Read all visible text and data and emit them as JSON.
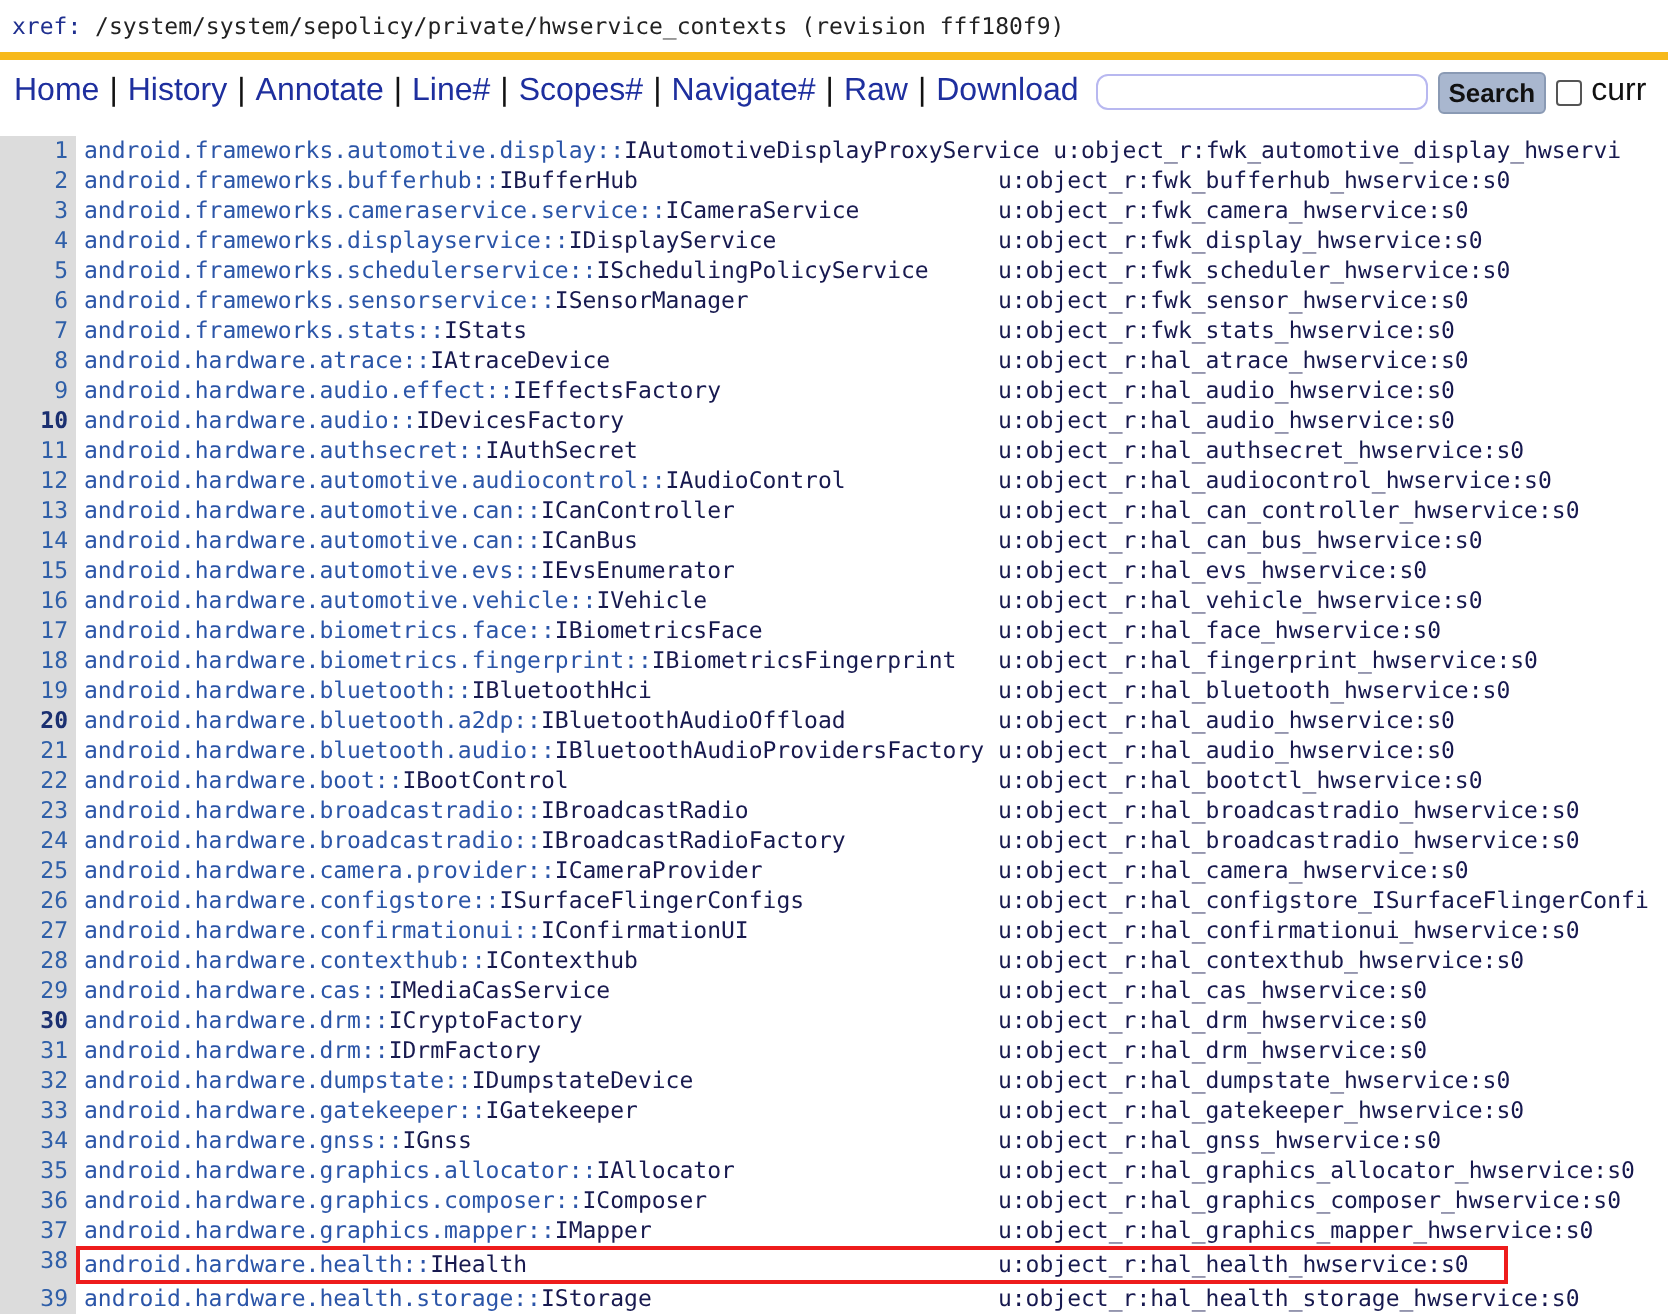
{
  "header": {
    "prefix": "xref:",
    "path": "/system/system/sepolicy/private/hwservice_contexts (revision fff180f9)"
  },
  "nav": [
    {
      "kind": "link",
      "label": "Home"
    },
    {
      "kind": "separator",
      "label": "|"
    },
    {
      "kind": "link",
      "label": "History"
    },
    {
      "kind": "separator",
      "label": "|"
    },
    {
      "kind": "link",
      "label": "Annotate"
    },
    {
      "kind": "separator",
      "label": "|"
    },
    {
      "kind": "link",
      "label": "Line#"
    },
    {
      "kind": "separator",
      "label": "|"
    },
    {
      "kind": "link",
      "label": "Scopes#"
    },
    {
      "kind": "separator",
      "label": "|"
    },
    {
      "kind": "link",
      "label": "Navigate#"
    },
    {
      "kind": "separator",
      "label": "|"
    },
    {
      "kind": "link",
      "label": "Raw"
    },
    {
      "kind": "separator",
      "label": "|"
    },
    {
      "kind": "link",
      "label": "Download"
    }
  ],
  "search": {
    "button": "Search",
    "checkbox_checked": false,
    "checkbox_label": "curr"
  },
  "lines": [
    {
      "number": "1",
      "pkg": "android.frameworks.automotive.display::",
      "iface": "IAutomotiveDisplayProxyService",
      "context": "u:object_r:fwk_automotive_display_hwservi",
      "highlighted": false
    },
    {
      "number": "2",
      "pkg": "android.frameworks.bufferhub::",
      "iface": "IBufferHub",
      "context": "u:object_r:fwk_bufferhub_hwservice:s0",
      "highlighted": false
    },
    {
      "number": "3",
      "pkg": "android.frameworks.cameraservice.service::",
      "iface": "ICameraService",
      "context": "u:object_r:fwk_camera_hwservice:s0",
      "highlighted": false
    },
    {
      "number": "4",
      "pkg": "android.frameworks.displayservice::",
      "iface": "IDisplayService",
      "context": "u:object_r:fwk_display_hwservice:s0",
      "highlighted": false
    },
    {
      "number": "5",
      "pkg": "android.frameworks.schedulerservice::",
      "iface": "ISchedulingPolicyService",
      "context": "u:object_r:fwk_scheduler_hwservice:s0",
      "highlighted": false
    },
    {
      "number": "6",
      "pkg": "android.frameworks.sensorservice::",
      "iface": "ISensorManager",
      "context": "u:object_r:fwk_sensor_hwservice:s0",
      "highlighted": false
    },
    {
      "number": "7",
      "pkg": "android.frameworks.stats::",
      "iface": "IStats",
      "context": "u:object_r:fwk_stats_hwservice:s0",
      "highlighted": false
    },
    {
      "number": "8",
      "pkg": "android.hardware.atrace::",
      "iface": "IAtraceDevice",
      "context": "u:object_r:hal_atrace_hwservice:s0",
      "highlighted": false
    },
    {
      "number": "9",
      "pkg": "android.hardware.audio.effect::",
      "iface": "IEffectsFactory",
      "context": "u:object_r:hal_audio_hwservice:s0",
      "highlighted": false
    },
    {
      "number": "10",
      "pkg": "android.hardware.audio::",
      "iface": "IDevicesFactory",
      "context": "u:object_r:hal_audio_hwservice:s0",
      "highlighted": false
    },
    {
      "number": "11",
      "pkg": "android.hardware.authsecret::",
      "iface": "IAuthSecret",
      "context": "u:object_r:hal_authsecret_hwservice:s0",
      "highlighted": false
    },
    {
      "number": "12",
      "pkg": "android.hardware.automotive.audiocontrol::",
      "iface": "IAudioControl",
      "context": "u:object_r:hal_audiocontrol_hwservice:s0",
      "highlighted": false
    },
    {
      "number": "13",
      "pkg": "android.hardware.automotive.can::",
      "iface": "ICanController",
      "context": "u:object_r:hal_can_controller_hwservice:s0",
      "highlighted": false
    },
    {
      "number": "14",
      "pkg": "android.hardware.automotive.can::",
      "iface": "ICanBus",
      "context": "u:object_r:hal_can_bus_hwservice:s0",
      "highlighted": false
    },
    {
      "number": "15",
      "pkg": "android.hardware.automotive.evs::",
      "iface": "IEvsEnumerator",
      "context": "u:object_r:hal_evs_hwservice:s0",
      "highlighted": false
    },
    {
      "number": "16",
      "pkg": "android.hardware.automotive.vehicle::",
      "iface": "IVehicle",
      "context": "u:object_r:hal_vehicle_hwservice:s0",
      "highlighted": false
    },
    {
      "number": "17",
      "pkg": "android.hardware.biometrics.face::",
      "iface": "IBiometricsFace",
      "context": "u:object_r:hal_face_hwservice:s0",
      "highlighted": false
    },
    {
      "number": "18",
      "pkg": "android.hardware.biometrics.fingerprint::",
      "iface": "IBiometricsFingerprint",
      "context": "u:object_r:hal_fingerprint_hwservice:s0",
      "highlighted": false
    },
    {
      "number": "19",
      "pkg": "android.hardware.bluetooth::",
      "iface": "IBluetoothHci",
      "context": "u:object_r:hal_bluetooth_hwservice:s0",
      "highlighted": false
    },
    {
      "number": "20",
      "pkg": "android.hardware.bluetooth.a2dp::",
      "iface": "IBluetoothAudioOffload",
      "context": "u:object_r:hal_audio_hwservice:s0",
      "highlighted": false
    },
    {
      "number": "21",
      "pkg": "android.hardware.bluetooth.audio::",
      "iface": "IBluetoothAudioProvidersFactory",
      "context": "u:object_r:hal_audio_hwservice:s0",
      "highlighted": false
    },
    {
      "number": "22",
      "pkg": "android.hardware.boot::",
      "iface": "IBootControl",
      "context": "u:object_r:hal_bootctl_hwservice:s0",
      "highlighted": false
    },
    {
      "number": "23",
      "pkg": "android.hardware.broadcastradio::",
      "iface": "IBroadcastRadio",
      "context": "u:object_r:hal_broadcastradio_hwservice:s0",
      "highlighted": false
    },
    {
      "number": "24",
      "pkg": "android.hardware.broadcastradio::",
      "iface": "IBroadcastRadioFactory",
      "context": "u:object_r:hal_broadcastradio_hwservice:s0",
      "highlighted": false
    },
    {
      "number": "25",
      "pkg": "android.hardware.camera.provider::",
      "iface": "ICameraProvider",
      "context": "u:object_r:hal_camera_hwservice:s0",
      "highlighted": false
    },
    {
      "number": "26",
      "pkg": "android.hardware.configstore::",
      "iface": "ISurfaceFlingerConfigs",
      "context": "u:object_r:hal_configstore_ISurfaceFlingerConfi",
      "highlighted": false
    },
    {
      "number": "27",
      "pkg": "android.hardware.confirmationui::",
      "iface": "IConfirmationUI",
      "context": "u:object_r:hal_confirmationui_hwservice:s0",
      "highlighted": false
    },
    {
      "number": "28",
      "pkg": "android.hardware.contexthub::",
      "iface": "IContexthub",
      "context": "u:object_r:hal_contexthub_hwservice:s0",
      "highlighted": false
    },
    {
      "number": "29",
      "pkg": "android.hardware.cas::",
      "iface": "IMediaCasService",
      "context": "u:object_r:hal_cas_hwservice:s0",
      "highlighted": false
    },
    {
      "number": "30",
      "pkg": "android.hardware.drm::",
      "iface": "ICryptoFactory",
      "context": "u:object_r:hal_drm_hwservice:s0",
      "highlighted": false
    },
    {
      "number": "31",
      "pkg": "android.hardware.drm::",
      "iface": "IDrmFactory",
      "context": "u:object_r:hal_drm_hwservice:s0",
      "highlighted": false
    },
    {
      "number": "32",
      "pkg": "android.hardware.dumpstate::",
      "iface": "IDumpstateDevice",
      "context": "u:object_r:hal_dumpstate_hwservice:s0",
      "highlighted": false
    },
    {
      "number": "33",
      "pkg": "android.hardware.gatekeeper::",
      "iface": "IGatekeeper",
      "context": "u:object_r:hal_gatekeeper_hwservice:s0",
      "highlighted": false
    },
    {
      "number": "34",
      "pkg": "android.hardware.gnss::",
      "iface": "IGnss",
      "context": "u:object_r:hal_gnss_hwservice:s0",
      "highlighted": false
    },
    {
      "number": "35",
      "pkg": "android.hardware.graphics.allocator::",
      "iface": "IAllocator",
      "context": "u:object_r:hal_graphics_allocator_hwservice:s0",
      "highlighted": false
    },
    {
      "number": "36",
      "pkg": "android.hardware.graphics.composer::",
      "iface": "IComposer",
      "context": "u:object_r:hal_graphics_composer_hwservice:s0",
      "highlighted": false
    },
    {
      "number": "37",
      "pkg": "android.hardware.graphics.mapper::",
      "iface": "IMapper",
      "context": "u:object_r:hal_graphics_mapper_hwservice:s0",
      "highlighted": false
    },
    {
      "number": "38",
      "pkg": "android.hardware.health::",
      "iface": "IHealth",
      "context": "u:object_r:hal_health_hwservice:s0",
      "highlighted": true
    },
    {
      "number": "39",
      "pkg": "android.hardware.health.storage::",
      "iface": "IStorage",
      "context": "u:object_r:hal_health_storage_hwservice:s0",
      "highlighted": false
    }
  ]
}
